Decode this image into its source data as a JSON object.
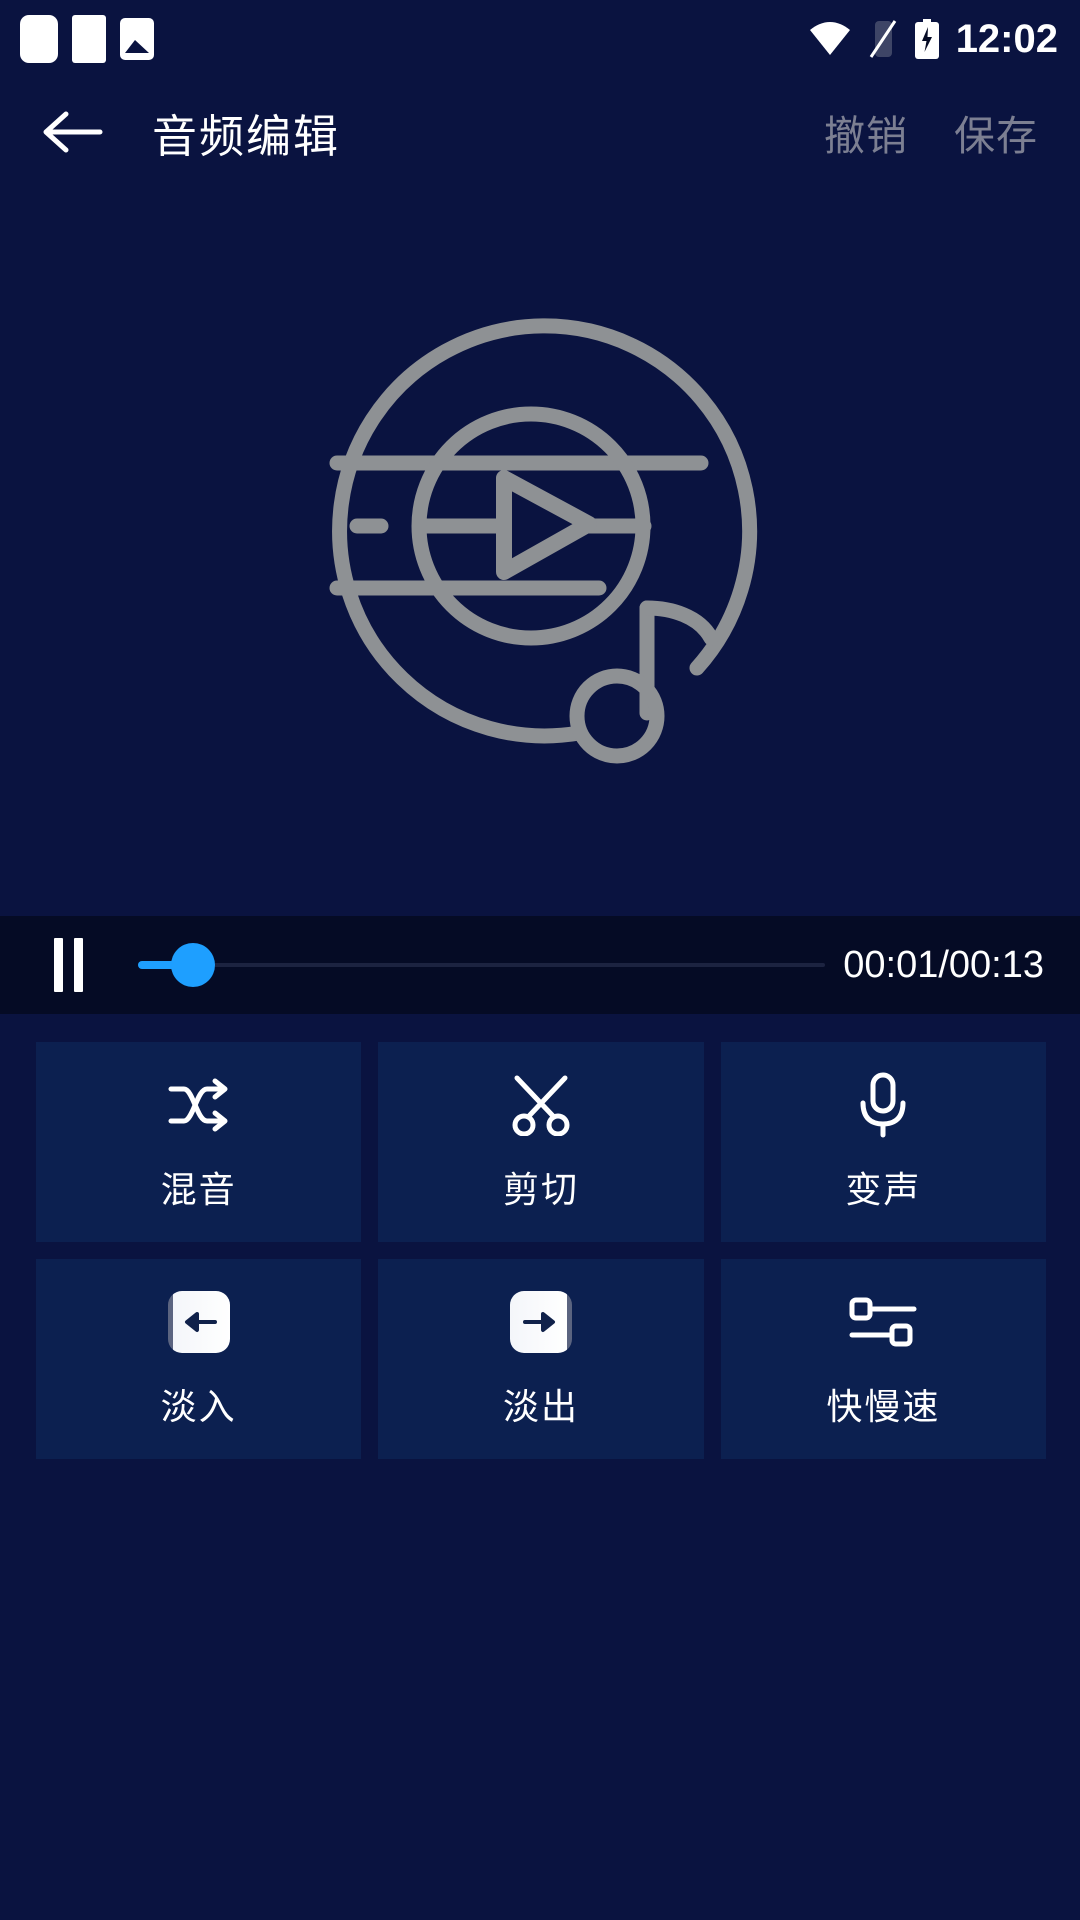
{
  "statusbar": {
    "time": "12:02",
    "icons_left": [
      "notification-icon",
      "notification-icon",
      "image-icon"
    ],
    "icons_right": [
      "wifi-icon",
      "signal-off-icon",
      "battery-charging-icon"
    ]
  },
  "header": {
    "back_icon": "arrow-left-icon",
    "title": "音频编辑",
    "undo_label": "撤销",
    "save_label": "保存"
  },
  "artwork": {
    "icon": "audio-disc-play-icon",
    "stroke_color": "#8e9194"
  },
  "player": {
    "state_icon": "pause-icon",
    "progress_percent": 8,
    "time_display": "00:01/00:13",
    "accent_color": "#1e9fff",
    "bar_color": "#050b25"
  },
  "tools": {
    "card_color": "#0c2050",
    "items": [
      {
        "icon": "shuffle-icon",
        "label": "混音"
      },
      {
        "icon": "scissors-icon",
        "label": "剪切"
      },
      {
        "icon": "microphone-icon",
        "label": "变声"
      },
      {
        "icon": "fade-in-icon",
        "label": "淡入"
      },
      {
        "icon": "fade-out-icon",
        "label": "淡出"
      },
      {
        "icon": "speed-slider-icon",
        "label": "快慢速"
      }
    ]
  },
  "theme": {
    "background": "#0a1340",
    "text_primary": "#ffffff",
    "text_muted": "#7c7f92"
  }
}
